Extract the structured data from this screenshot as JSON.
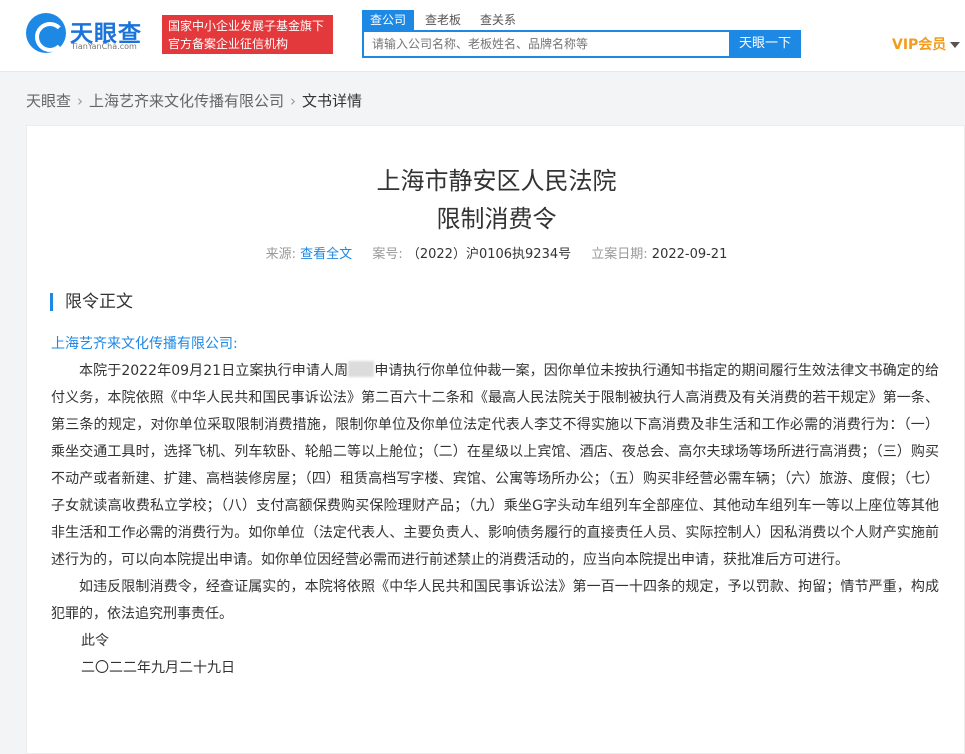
{
  "header": {
    "logo_main": "天眼查",
    "logo_sub": "TianYanCha.com",
    "tag_line1": "国家中小企业发展子基金旗下",
    "tag_line2": "官方备案企业征信机构",
    "tabs": [
      "查公司",
      "查老板",
      "查关系"
    ],
    "search_placeholder": "请输入公司名称、老板姓名、品牌名称等",
    "search_button": "天眼一下",
    "vip_label": "VIP会员"
  },
  "breadcrumb": {
    "home": "天眼查",
    "company": "上海艺齐来文化传播有限公司",
    "current": "文书详情"
  },
  "document": {
    "court": "上海市静安区人民法院",
    "title": "限制消费令",
    "source_label": "来源:",
    "source_link": "查看全文",
    "case_no_label": "案号:",
    "case_no": "（2022）沪0106执9234号",
    "filed_label": "立案日期:",
    "filed_date": "2022-09-21",
    "section_title": "限令正文",
    "addressee": "上海艺齐来文化传播有限公司:",
    "para1_a": "本院于2022年09月21日立案执行申请人周",
    "para1_b": "申请执行你单位仲裁一案，因你单位未按执行通知书指定的期间履行生效法律文书确定的给付义务，本院依照《中华人民共和国民事诉讼法》第二百六十二条和《最高人民法院关于限制被执行人高消费及有关消费的若干规定》第一条、第三条的规定，对你单位采取限制消费措施，限制你单位及你单位法定代表人李艾不得实施以下高消费及非生活和工作必需的消费行为：（一）乘坐交通工具时，选择飞机、列车软卧、轮船二等以上舱位；（二）在星级以上宾馆、酒店、夜总会、高尔夫球场等场所进行高消费；（三）购买不动产或者新建、扩建、高档装修房屋；（四）租赁高档写字楼、宾馆、公寓等场所办公；（五）购买非经营必需车辆；（六）旅游、度假；（七）子女就读高收费私立学校；（八）支付高额保费购买保险理财产品；（九）乘坐G字头动车组列车全部座位、其他动车组列车一等以上座位等其他非生活和工作必需的消费行为。如你单位（法定代表人、主要负责人、影响债务履行的直接责任人员、实际控制人）因私消费以个人财产实施前述行为的，可以向本院提出申请。如你单位因经营必需而进行前述禁止的消费活动的，应当向本院提出申请，获批准后方可进行。",
    "para2": "如违反限制消费令，经查证属实的，本院将依照《中华人民共和国民事诉讼法》第一百一十四条的规定，予以罚款、拘留；情节严重，构成犯罪的，依法追究刑事责任。",
    "closing": "此令",
    "date_line": "二〇二二年九月二十九日"
  }
}
